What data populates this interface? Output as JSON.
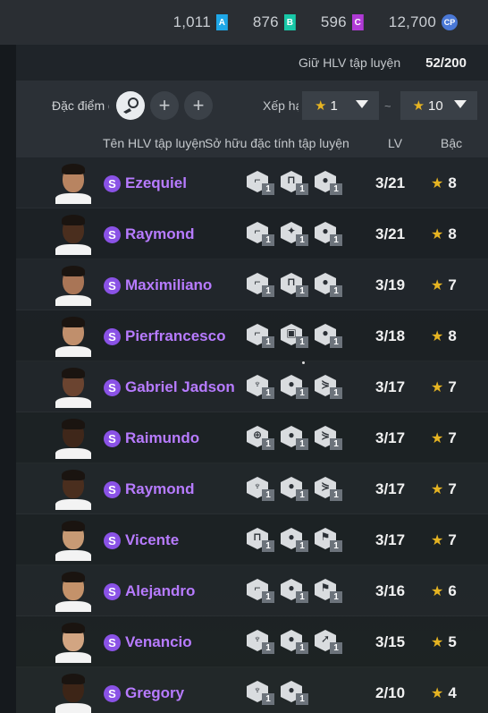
{
  "currency": [
    {
      "value": "1,011",
      "badge": "A",
      "color": "#1ea7e8"
    },
    {
      "value": "876",
      "badge": "B",
      "color": "#18c8a8"
    },
    {
      "value": "596",
      "badge": "C",
      "color": "#b03ad6"
    },
    {
      "value": "12,700",
      "badge": "CP",
      "color": "#4a78d6"
    }
  ],
  "capacity": {
    "label": "Giữ HLV tập luyện",
    "value": "52/200"
  },
  "filter": {
    "trait_label": "Đặc điểm đ",
    "add_symbol": "+",
    "rank_label": "Xếp hạng",
    "rank_from": "1",
    "rank_to": "10",
    "tilde": "~"
  },
  "columns": {
    "name": "Tên HLV tập luyện",
    "traits": "Sở hữu đặc tính tập luyện",
    "lv": "LV",
    "rank": "Bậc"
  },
  "coaches": [
    {
      "name": "Ezequiel",
      "lv": "3/21",
      "rank": "8",
      "skin": "#b88461",
      "traits": [
        {
          "icon": "boot-icon",
          "level": "1"
        },
        {
          "icon": "goal-icon",
          "level": "1"
        },
        {
          "icon": "ball-foot-icon",
          "level": "1"
        }
      ]
    },
    {
      "name": "Raymond",
      "lv": "3/21",
      "rank": "8",
      "skin": "#4a2e1e",
      "traits": [
        {
          "icon": "boot-icon",
          "level": "1"
        },
        {
          "icon": "star-player-icon",
          "level": "1"
        },
        {
          "icon": "ball-foot-icon",
          "level": "1"
        }
      ]
    },
    {
      "name": "Maximiliano",
      "lv": "3/19",
      "rank": "7",
      "skin": "#a97556",
      "traits": [
        {
          "icon": "boot-icon",
          "level": "1"
        },
        {
          "icon": "goal-icon",
          "level": "1"
        },
        {
          "icon": "ball-foot-icon",
          "level": "1"
        }
      ]
    },
    {
      "name": "Pierfrancesco",
      "lv": "3/18",
      "rank": "8",
      "skin": "#c08f6c",
      "traits": [
        {
          "icon": "boot-icon",
          "level": "1"
        },
        {
          "icon": "keeper-icon",
          "level": "1"
        },
        {
          "icon": "ball-foot-icon",
          "level": "1"
        }
      ]
    },
    {
      "name": "Gabriel Jadson",
      "lv": "3/17",
      "rank": "7",
      "skin": "#6b4430",
      "traits": [
        {
          "icon": "trophy-icon",
          "level": "1"
        },
        {
          "icon": "ball-foot-icon",
          "level": "1"
        },
        {
          "icon": "whistle-icon",
          "level": "1"
        }
      ]
    },
    {
      "name": "Raimundo",
      "lv": "3/17",
      "rank": "7",
      "skin": "#3f271a",
      "traits": [
        {
          "icon": "target-icon",
          "level": "1"
        },
        {
          "icon": "ball-foot-icon",
          "level": "1"
        },
        {
          "icon": "whistle-icon",
          "level": "1"
        }
      ]
    },
    {
      "name": "Raymond",
      "lv": "3/17",
      "rank": "7",
      "skin": "#4a2e1e",
      "traits": [
        {
          "icon": "trophy-icon",
          "level": "1"
        },
        {
          "icon": "ball-foot-icon",
          "level": "1"
        },
        {
          "icon": "whistle-icon",
          "level": "1"
        }
      ]
    },
    {
      "name": "Vicente",
      "lv": "3/17",
      "rank": "7",
      "skin": "#c79a74",
      "traits": [
        {
          "icon": "goal-icon",
          "level": "1"
        },
        {
          "icon": "ball-foot-icon",
          "level": "1"
        },
        {
          "icon": "runner-icon",
          "level": "1"
        }
      ]
    },
    {
      "name": "Alejandro",
      "lv": "3/16",
      "rank": "6",
      "skin": "#c4926a",
      "traits": [
        {
          "icon": "boot-icon",
          "level": "1"
        },
        {
          "icon": "ball-foot-icon",
          "level": "1"
        },
        {
          "icon": "runner-icon",
          "level": "1"
        }
      ]
    },
    {
      "name": "Venancio",
      "lv": "3/15",
      "rank": "5",
      "skin": "#d2a582",
      "traits": [
        {
          "icon": "trophy-icon",
          "level": "1"
        },
        {
          "icon": "ball-foot-icon",
          "level": "1"
        },
        {
          "icon": "sprint-icon",
          "level": "1"
        }
      ]
    },
    {
      "name": "Gregory",
      "lv": "2/10",
      "rank": "4",
      "skin": "#3d2517",
      "traits": [
        {
          "icon": "trophy-icon",
          "level": "1"
        },
        {
          "icon": "ball-foot-icon",
          "level": "1"
        }
      ]
    }
  ]
}
